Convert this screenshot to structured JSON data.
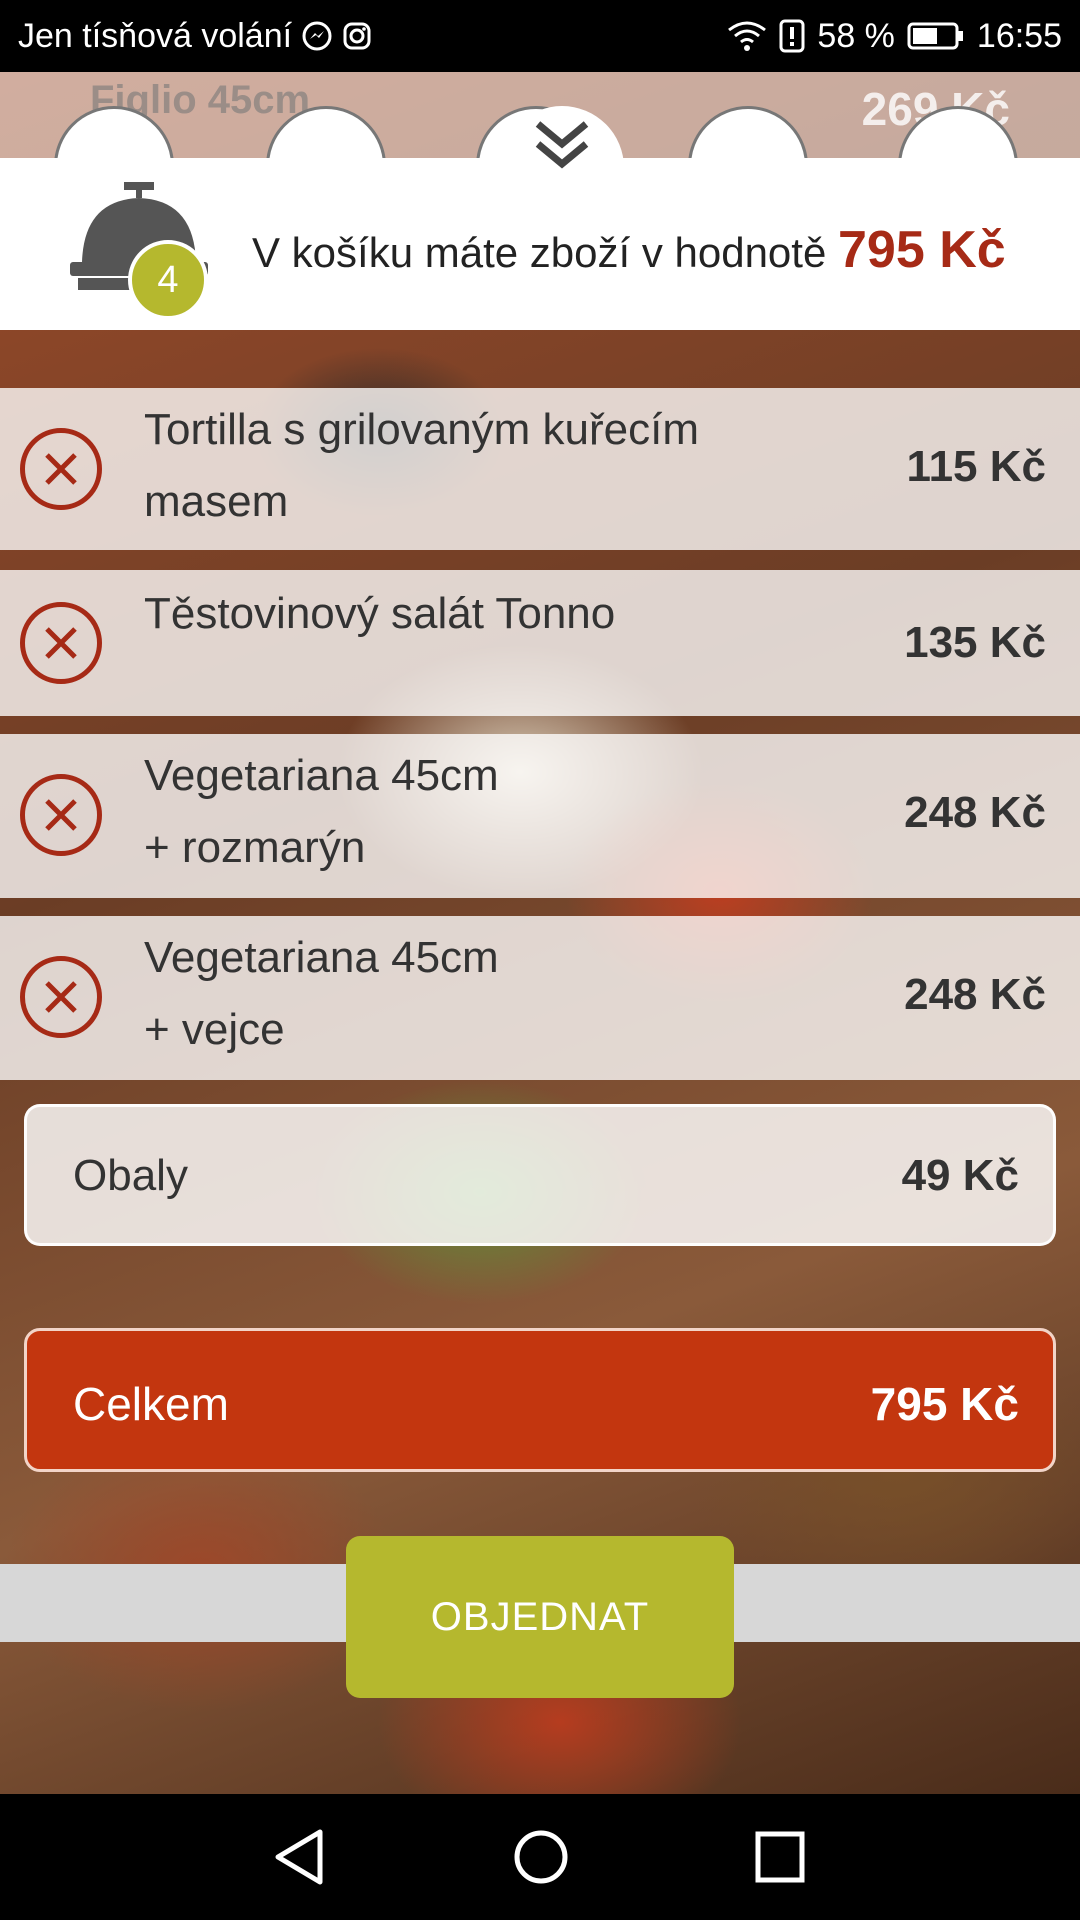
{
  "status_bar": {
    "carrier": "Jen tísňová volání",
    "battery": "58 %",
    "time": "16:55"
  },
  "peek": {
    "item_name": "Figlio 45cm",
    "item_price": "269 Kč"
  },
  "cart": {
    "count": "4",
    "summary_text": "V košíku máte zboží v hodnotě",
    "summary_total": "795 Kč"
  },
  "items": [
    {
      "name_line1": "Tortilla s grilovaným kuřecím",
      "name_line2": "masem",
      "price": "115 Kč"
    },
    {
      "name_line1": "Těstovinový salát Tonno",
      "name_line2": "",
      "price": "135 Kč"
    },
    {
      "name_line1": "Vegetariana 45cm",
      "name_line2": "+ rozmarýn",
      "price": "248 Kč"
    },
    {
      "name_line1": "Vegetariana 45cm",
      "name_line2": "+ vejce",
      "price": "248 Kč"
    }
  ],
  "packaging": {
    "label": "Obaly",
    "price": "49 Kč"
  },
  "total": {
    "label": "Celkem",
    "price": "795 Kč"
  },
  "order_button": "OBJEDNAT",
  "colors": {
    "accent_red": "#a62a16",
    "total_bar": "#c3360f",
    "olive": "#b5b82e"
  },
  "icons": {
    "status_left": [
      "messenger-icon",
      "instagram-icon"
    ],
    "status_right": [
      "wifi-icon",
      "alert-icon",
      "battery-icon"
    ],
    "nav": [
      "back-icon",
      "home-icon",
      "recents-icon"
    ]
  }
}
